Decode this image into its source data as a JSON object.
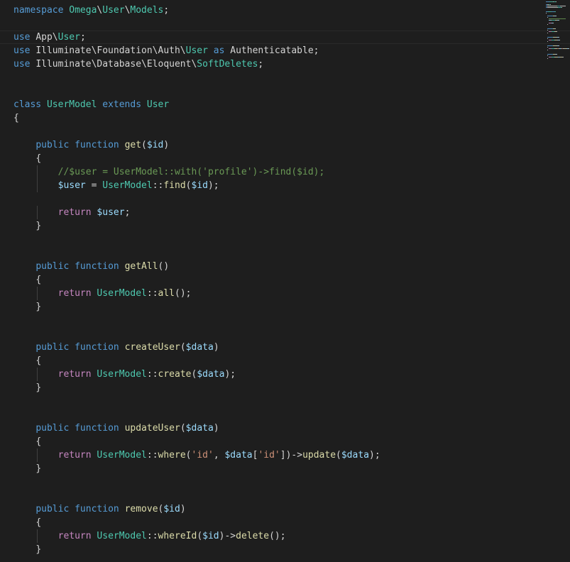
{
  "editor": {
    "theme": "dark",
    "background": "#1e1e1e",
    "colors": {
      "keyword": "#569cd6",
      "control": "#c586c0",
      "function": "#dcdcaa",
      "class": "#4ec9b0",
      "variable": "#9cdcfe",
      "string": "#ce9178",
      "comment": "#6a9955",
      "plain": "#d4d4d4"
    },
    "lines": [
      [
        {
          "t": "namespace ",
          "c": "kw"
        },
        {
          "t": "Omega",
          "c": "cls"
        },
        {
          "t": "\\",
          "c": "pun"
        },
        {
          "t": "User",
          "c": "cls"
        },
        {
          "t": "\\",
          "c": "pun"
        },
        {
          "t": "Models",
          "c": "cls"
        },
        {
          "t": ";",
          "c": "pun"
        }
      ],
      [],
      [
        {
          "t": "use ",
          "c": "kw"
        },
        {
          "t": "App",
          "c": "pun"
        },
        {
          "t": "\\",
          "c": "pun"
        },
        {
          "t": "User",
          "c": "cls"
        },
        {
          "t": ";",
          "c": "pun"
        }
      ],
      [
        {
          "t": "use ",
          "c": "kw"
        },
        {
          "t": "Illuminate\\Foundation\\Auth\\",
          "c": "pun"
        },
        {
          "t": "User",
          "c": "cls"
        },
        {
          "t": " as ",
          "c": "kw"
        },
        {
          "t": "Authenticatable",
          "c": "pun"
        },
        {
          "t": ";",
          "c": "pun"
        }
      ],
      [
        {
          "t": "use ",
          "c": "kw"
        },
        {
          "t": "Illuminate\\Database\\Eloquent\\",
          "c": "pun"
        },
        {
          "t": "SoftDeletes",
          "c": "cls"
        },
        {
          "t": ";",
          "c": "pun"
        }
      ],
      [],
      [],
      [
        {
          "t": "class ",
          "c": "kw"
        },
        {
          "t": "UserModel",
          "c": "cls"
        },
        {
          "t": " extends ",
          "c": "kw"
        },
        {
          "t": "User",
          "c": "cls"
        }
      ],
      [
        {
          "t": "{",
          "c": "pun"
        }
      ],
      [],
      [
        {
          "t": "    "
        },
        {
          "t": "public ",
          "c": "kw"
        },
        {
          "t": "function ",
          "c": "kw"
        },
        {
          "t": "get",
          "c": "fn"
        },
        {
          "t": "(",
          "c": "pun"
        },
        {
          "t": "$id",
          "c": "var"
        },
        {
          "t": ")",
          "c": "pun"
        }
      ],
      [
        {
          "t": "    "
        },
        {
          "t": "{",
          "c": "pun"
        }
      ],
      [
        {
          "t": "        "
        },
        {
          "t": "//$user = UserModel::with('profile')->find($id);",
          "c": "cmt"
        }
      ],
      [
        {
          "t": "        "
        },
        {
          "t": "$user",
          "c": "var"
        },
        {
          "t": " = ",
          "c": "pun"
        },
        {
          "t": "UserModel",
          "c": "cls"
        },
        {
          "t": "::",
          "c": "pun"
        },
        {
          "t": "find",
          "c": "fn"
        },
        {
          "t": "(",
          "c": "pun"
        },
        {
          "t": "$id",
          "c": "var"
        },
        {
          "t": ");",
          "c": "pun"
        }
      ],
      [],
      [
        {
          "t": "        "
        },
        {
          "t": "return ",
          "c": "ctl"
        },
        {
          "t": "$user",
          "c": "var"
        },
        {
          "t": ";",
          "c": "pun"
        }
      ],
      [
        {
          "t": "    "
        },
        {
          "t": "}",
          "c": "pun"
        }
      ],
      [],
      [],
      [
        {
          "t": "    "
        },
        {
          "t": "public ",
          "c": "kw"
        },
        {
          "t": "function ",
          "c": "kw"
        },
        {
          "t": "getAll",
          "c": "fn"
        },
        {
          "t": "()",
          "c": "pun"
        }
      ],
      [
        {
          "t": "    "
        },
        {
          "t": "{",
          "c": "pun"
        }
      ],
      [
        {
          "t": "        "
        },
        {
          "t": "return ",
          "c": "ctl"
        },
        {
          "t": "UserModel",
          "c": "cls"
        },
        {
          "t": "::",
          "c": "pun"
        },
        {
          "t": "all",
          "c": "fn"
        },
        {
          "t": "();",
          "c": "pun"
        }
      ],
      [
        {
          "t": "    "
        },
        {
          "t": "}",
          "c": "pun"
        }
      ],
      [],
      [],
      [
        {
          "t": "    "
        },
        {
          "t": "public ",
          "c": "kw"
        },
        {
          "t": "function ",
          "c": "kw"
        },
        {
          "t": "createUser",
          "c": "fn"
        },
        {
          "t": "(",
          "c": "pun"
        },
        {
          "t": "$data",
          "c": "var"
        },
        {
          "t": ")",
          "c": "pun"
        }
      ],
      [
        {
          "t": "    "
        },
        {
          "t": "{",
          "c": "pun"
        }
      ],
      [
        {
          "t": "        "
        },
        {
          "t": "return ",
          "c": "ctl"
        },
        {
          "t": "UserModel",
          "c": "cls"
        },
        {
          "t": "::",
          "c": "pun"
        },
        {
          "t": "create",
          "c": "fn"
        },
        {
          "t": "(",
          "c": "pun"
        },
        {
          "t": "$data",
          "c": "var"
        },
        {
          "t": ");",
          "c": "pun"
        }
      ],
      [
        {
          "t": "    "
        },
        {
          "t": "}",
          "c": "pun"
        }
      ],
      [],
      [],
      [
        {
          "t": "    "
        },
        {
          "t": "public ",
          "c": "kw"
        },
        {
          "t": "function ",
          "c": "kw"
        },
        {
          "t": "updateUser",
          "c": "fn"
        },
        {
          "t": "(",
          "c": "pun"
        },
        {
          "t": "$data",
          "c": "var"
        },
        {
          "t": ")",
          "c": "pun"
        }
      ],
      [
        {
          "t": "    "
        },
        {
          "t": "{",
          "c": "pun"
        }
      ],
      [
        {
          "t": "        "
        },
        {
          "t": "return ",
          "c": "ctl"
        },
        {
          "t": "UserModel",
          "c": "cls"
        },
        {
          "t": "::",
          "c": "pun"
        },
        {
          "t": "where",
          "c": "fn"
        },
        {
          "t": "(",
          "c": "pun"
        },
        {
          "t": "'id'",
          "c": "str"
        },
        {
          "t": ", ",
          "c": "pun"
        },
        {
          "t": "$data",
          "c": "var"
        },
        {
          "t": "[",
          "c": "pun"
        },
        {
          "t": "'id'",
          "c": "str"
        },
        {
          "t": "])->",
          "c": "pun"
        },
        {
          "t": "update",
          "c": "fn"
        },
        {
          "t": "(",
          "c": "pun"
        },
        {
          "t": "$data",
          "c": "var"
        },
        {
          "t": ");",
          "c": "pun"
        }
      ],
      [
        {
          "t": "    "
        },
        {
          "t": "}",
          "c": "pun"
        }
      ],
      [],
      [],
      [
        {
          "t": "    "
        },
        {
          "t": "public ",
          "c": "kw"
        },
        {
          "t": "function ",
          "c": "kw"
        },
        {
          "t": "remove",
          "c": "fn"
        },
        {
          "t": "(",
          "c": "pun"
        },
        {
          "t": "$id",
          "c": "var"
        },
        {
          "t": ")",
          "c": "pun"
        }
      ],
      [
        {
          "t": "    "
        },
        {
          "t": "{",
          "c": "pun"
        }
      ],
      [
        {
          "t": "        "
        },
        {
          "t": "return ",
          "c": "ctl"
        },
        {
          "t": "UserModel",
          "c": "cls"
        },
        {
          "t": "::",
          "c": "pun"
        },
        {
          "t": "whereId",
          "c": "fn"
        },
        {
          "t": "(",
          "c": "pun"
        },
        {
          "t": "$id",
          "c": "var"
        },
        {
          "t": ")->",
          "c": "pun"
        },
        {
          "t": "delete",
          "c": "fn"
        },
        {
          "t": "();",
          "c": "pun"
        }
      ],
      [
        {
          "t": "    "
        },
        {
          "t": "}",
          "c": "pun"
        }
      ]
    ]
  }
}
